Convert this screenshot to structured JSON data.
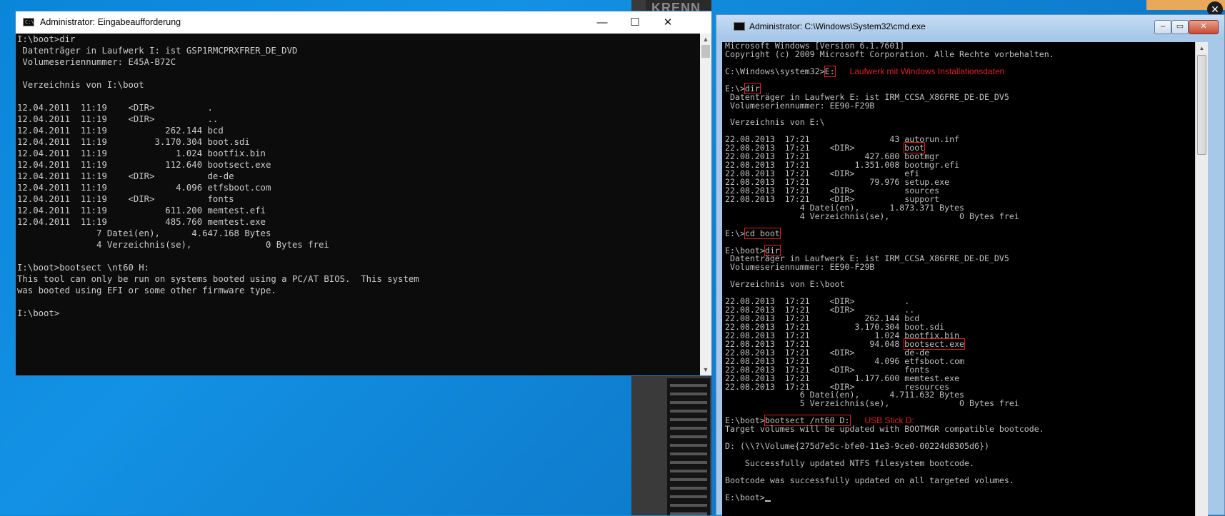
{
  "background": {
    "bg_label": "KRENN",
    "close_glyph": "✕"
  },
  "win10": {
    "title": "Administrator: Eingabeaufforderung",
    "icon_label": "C:\\",
    "controls": {
      "minimize": "—",
      "maximize": "☐",
      "close": "✕"
    },
    "scroll_up": "▲",
    "scroll_down": "▼",
    "lines": [
      "I:\\boot>dir",
      " Datenträger in Laufwerk I: ist GSP1RMCPRXFRER_DE_DVD",
      " Volumeseriennummer: E45A-B72C",
      "",
      " Verzeichnis von I:\\boot",
      "",
      "12.04.2011  11:19    <DIR>          .",
      "12.04.2011  11:19    <DIR>          ..",
      "12.04.2011  11:19           262.144 bcd",
      "12.04.2011  11:19         3.170.304 boot.sdi",
      "12.04.2011  11:19             1.024 bootfix.bin",
      "12.04.2011  11:19           112.640 bootsect.exe",
      "12.04.2011  11:19    <DIR>          de-de",
      "12.04.2011  11:19             4.096 etfsboot.com",
      "12.04.2011  11:19    <DIR>          fonts",
      "12.04.2011  11:19           611.200 memtest.efi",
      "12.04.2011  11:19           485.760 memtest.exe",
      "               7 Datei(en),      4.647.168 Bytes",
      "               4 Verzeichnis(se),              0 Bytes frei",
      "",
      "I:\\boot>bootsect \\nt60 H:",
      "This tool can only be run on systems booted using a PC/AT BIOS.  This system",
      "was booted using EFI or some other firmware type.",
      "",
      "I:\\boot>"
    ]
  },
  "win7": {
    "title": "Administrator: C:\\Windows\\System32\\cmd.exe",
    "controls": {
      "minimize": "–",
      "maximize": "▭",
      "close": "✕"
    },
    "scroll_up": "▲",
    "header_lines": [
      "Microsoft Windows [Version 6.1.7601]",
      "Copyright (c) 2009 Microsoft Corporation. Alle Rechte vorbehalten."
    ],
    "prompt_system32": "C:\\Windows\\system32>",
    "cmd_e": "E:",
    "note_e": "Laufwerk mit Windows Installationsdaten",
    "prompt_e": "E:\\>",
    "cmd_dir": "dir",
    "vol_lines": [
      " Datenträger in Laufwerk E: ist IRM_CCSA_X86FRE_DE-DE_DV5",
      " Volumeseriennummer: EE90-F29B"
    ],
    "dir_e_header": " Verzeichnis von E:\\",
    "dir_e_boot_prefix": "22.08.2013  17:21    <DIR>          ",
    "dir_e_boot_name": "boot",
    "dir_e_rows": [
      "22.08.2013  17:21                43 autorun.inf",
      "22.08.2013  17:21           427.680 bootmgr",
      "22.08.2013  17:21         1.351.008 bootmgr.efi",
      "22.08.2013  17:21    <DIR>          efi",
      "22.08.2013  17:21            79.976 setup.exe",
      "22.08.2013  17:21    <DIR>          sources",
      "22.08.2013  17:21    <DIR>          support",
      "               4 Datei(en),      1.873.371 Bytes",
      "               4 Verzeichnis(se),              0 Bytes frei"
    ],
    "cmd_cdboot": "cd boot",
    "prompt_eboot": "E:\\boot>",
    "dir_boot_header": " Verzeichnis von E:\\boot",
    "dir_boot_rows_a": [
      "22.08.2013  17:21    <DIR>          .",
      "22.08.2013  17:21    <DIR>          ..",
      "22.08.2013  17:21           262.144 bcd",
      "22.08.2013  17:21         3.170.304 boot.sdi",
      "22.08.2013  17:21             1.024 bootfix.bin"
    ],
    "dir_bootsect_prefix": "22.08.2013  17:21            94.048 ",
    "dir_bootsect_name": "bootsect.exe",
    "dir_boot_rows_b": [
      "22.08.2013  17:21    <DIR>          de-de",
      "22.08.2013  17:21             4.096 etfsboot.com",
      "22.08.2013  17:21    <DIR>          fonts",
      "22.08.2013  17:21         1.177.600 memtest.exe",
      "22.08.2013  17:21    <DIR>          resources",
      "               6 Datei(en),      4.711.632 Bytes",
      "               5 Verzeichnis(se),              0 Bytes frei"
    ],
    "cmd_bootsect": "bootsect /nt60 D:",
    "note_bootsect": "USB Stick D:",
    "result_lines": [
      "Target volumes will be updated with BOOTMGR compatible bootcode.",
      "",
      "D: (\\\\?\\Volume{275d7e5c-bfe0-11e3-9ce0-00224d8305d6})",
      "",
      "    Successfully updated NTFS filesystem bootcode.",
      "",
      "Bootcode was successfully updated on all targeted volumes.",
      ""
    ],
    "final_prompt": "E:\\boot>"
  }
}
